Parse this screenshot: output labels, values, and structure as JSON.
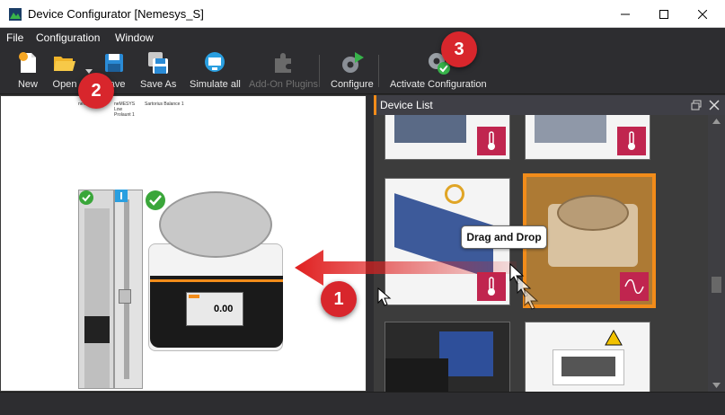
{
  "window": {
    "title": "Device Configurator [Nemesys_S]",
    "minimize_glyph": "—",
    "maximize_glyph": "☐",
    "close_glyph": "✕"
  },
  "menu": [
    "File",
    "Configuration",
    "Window"
  ],
  "toolbar": {
    "new_label": "New",
    "open_label": "Open",
    "save_label": "Save",
    "save_as_label": "Save As",
    "simulate_label": "Simulate all",
    "plugins_label": "Add-On Plugins",
    "configure_label": "Configure",
    "activate_label": "Activate Configuration"
  },
  "canvas": {
    "labels": [
      "neMESYS",
      "Low",
      "Prolaunt 1"
    ],
    "balance_label": "Sartorius Balance 1",
    "display_value": "0.00"
  },
  "device_list": {
    "title": "Device List",
    "tooltip": "Drag and Drop"
  },
  "markers": {
    "one": "1",
    "two": "2",
    "three": "3"
  },
  "colors": {
    "accent": "#f28c1a",
    "marker": "#d8262c",
    "badge": "#c0254f",
    "check": "#3aa63a"
  },
  "icons": [
    "new-icon",
    "open-folder-icon",
    "save-icon",
    "save-as-icon",
    "monitor-icon",
    "puzzle-icon",
    "gear-play-icon",
    "gear-check-icon",
    "thermometer-icon",
    "sine-wave-icon"
  ]
}
